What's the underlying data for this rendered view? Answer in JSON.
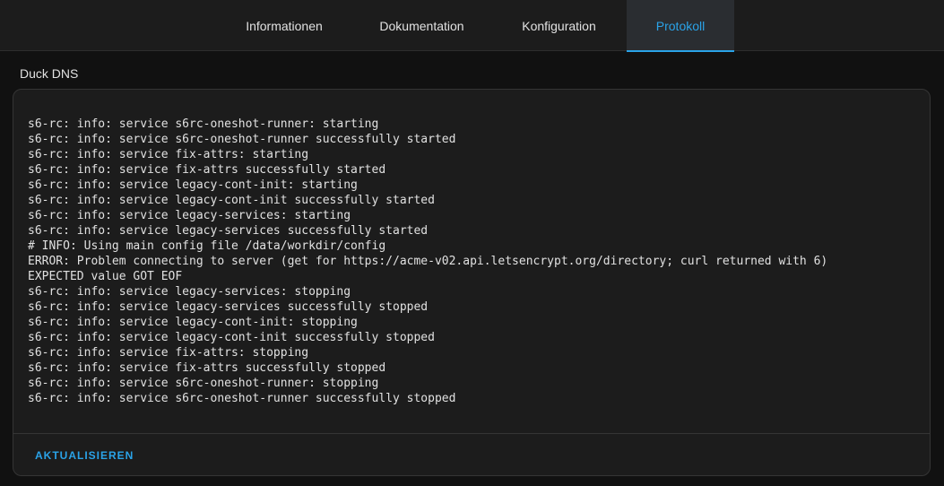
{
  "tabs": [
    {
      "label": "Informationen",
      "active": false
    },
    {
      "label": "Dokumentation",
      "active": false
    },
    {
      "label": "Konfiguration",
      "active": false
    },
    {
      "label": "Protokoll",
      "active": true
    }
  ],
  "card": {
    "title": "Duck DNS",
    "log_lines": [
      "s6-rc: info: service s6rc-oneshot-runner: starting",
      "s6-rc: info: service s6rc-oneshot-runner successfully started",
      "s6-rc: info: service fix-attrs: starting",
      "s6-rc: info: service fix-attrs successfully started",
      "s6-rc: info: service legacy-cont-init: starting",
      "s6-rc: info: service legacy-cont-init successfully started",
      "s6-rc: info: service legacy-services: starting",
      "s6-rc: info: service legacy-services successfully started",
      "# INFO: Using main config file /data/workdir/config",
      "ERROR: Problem connecting to server (get for https://acme-v02.api.letsencrypt.org/directory; curl returned with 6)",
      "EXPECTED value GOT EOF",
      "s6-rc: info: service legacy-services: stopping",
      "s6-rc: info: service legacy-services successfully stopped",
      "s6-rc: info: service legacy-cont-init: stopping",
      "s6-rc: info: service legacy-cont-init successfully stopped",
      "s6-rc: info: service fix-attrs: stopping",
      "s6-rc: info: service fix-attrs successfully stopped",
      "s6-rc: info: service s6rc-oneshot-runner: stopping",
      "s6-rc: info: service s6rc-oneshot-runner successfully stopped"
    ],
    "refresh_label": "AKTUALISIEREN"
  },
  "colors": {
    "accent": "#2aa3e8",
    "background": "#111111",
    "card": "#1c1c1c"
  }
}
